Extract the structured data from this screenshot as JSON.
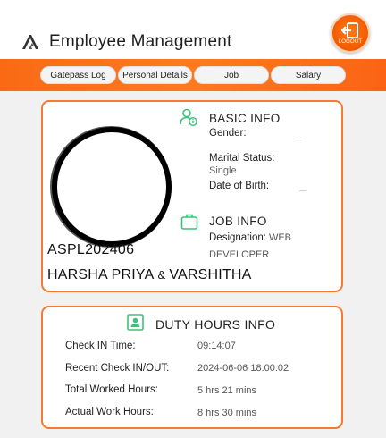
{
  "app": {
    "title": "Employee Management",
    "logout_label": "LOGOUT",
    "accent_color": "#f96a18",
    "card_border_color": "#f57a32",
    "icon_green": "#3ec27a"
  },
  "tabs": [
    {
      "label": "Gatepass Log"
    },
    {
      "label": "Personal Details"
    },
    {
      "label": "Job"
    },
    {
      "label": "Salary"
    }
  ],
  "profile": {
    "employee_id": "ASPL202406",
    "name_first": "HARSHA PRIYA",
    "name_amp": "&",
    "name_second": "VARSHITHA"
  },
  "basic_info": {
    "title": "BASIC INFO",
    "gender_label": "Gender:",
    "gender_value": "",
    "marital_label": "Marital Status:",
    "marital_value": "Single",
    "dob_label": "Date of Birth:",
    "dob_value": ""
  },
  "job_info": {
    "title": "JOB INFO",
    "designation_label": "Designation:",
    "designation_value_line1": "WEB",
    "designation_value_line2": "DEVELOPER"
  },
  "duty_hours": {
    "title": "DUTY HOURS INFO",
    "rows": [
      {
        "label": "Check IN Time:",
        "value": "09:14:07"
      },
      {
        "label": "Recent Check IN/OUT:",
        "value": "2024-06-06 18:00:02"
      },
      {
        "label": "Total Worked Hours:",
        "value": "5 hrs 21 mins"
      },
      {
        "label": "Actual Work Hours:",
        "value": "8 hrs 30 mins"
      }
    ]
  }
}
